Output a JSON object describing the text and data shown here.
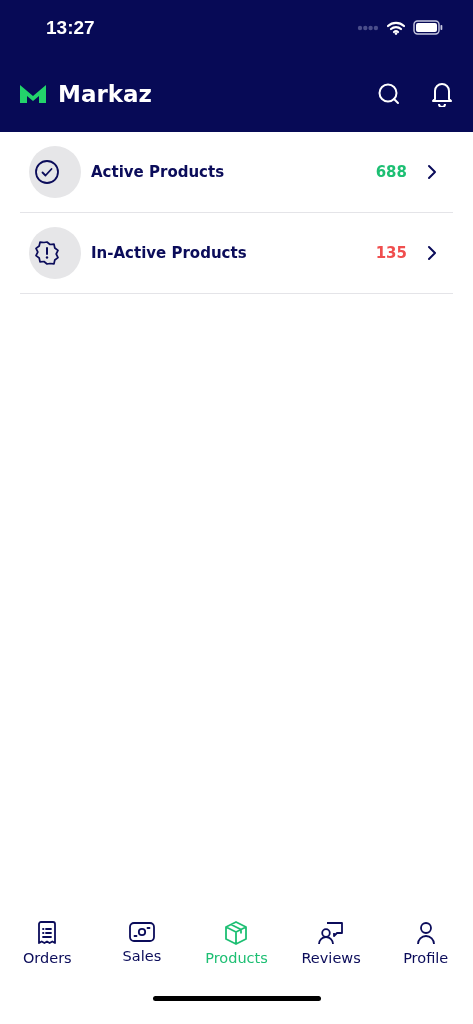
{
  "status_bar": {
    "time": "13:27"
  },
  "header": {
    "title": "Markaz"
  },
  "items": [
    {
      "kind": "active",
      "label": "Active Products",
      "count": "688",
      "color": "#1dbf73"
    },
    {
      "kind": "inactive",
      "label": "In-Active Products",
      "count": "135",
      "color": "#f04e4e"
    }
  ],
  "tabs": [
    {
      "kind": "orders",
      "label": "Orders",
      "selected": false
    },
    {
      "kind": "sales",
      "label": "Sales",
      "selected": false
    },
    {
      "kind": "products",
      "label": "Products",
      "selected": true
    },
    {
      "kind": "reviews",
      "label": "Reviews",
      "selected": false
    },
    {
      "kind": "profile",
      "label": "Profile",
      "selected": false
    }
  ]
}
